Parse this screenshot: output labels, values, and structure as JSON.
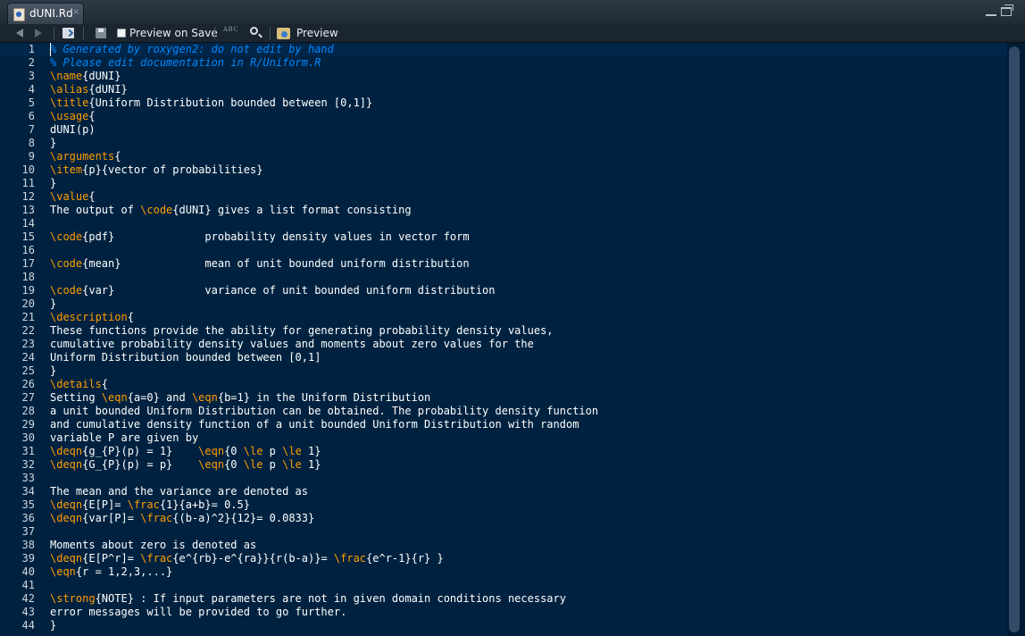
{
  "tab": {
    "title": "dUNI.Rd",
    "close": "×"
  },
  "toolbar": {
    "preview_on_save_label": "Preview on Save",
    "spellcheck_label": "ABC",
    "preview_label": "Preview"
  },
  "colors": {
    "background": "#002240",
    "keyword": "#ff9d00",
    "comment": "#0088ff",
    "text": "#ffffff"
  },
  "editor": {
    "lines": [
      [
        {
          "c": "cm",
          "t": "% Generated by roxygen2: do not edit by hand"
        }
      ],
      [
        {
          "c": "cm",
          "t": "% Please edit documentation in R/Uniform.R"
        }
      ],
      [
        {
          "c": "kw",
          "t": "\\name"
        },
        {
          "c": "",
          "t": "{dUNI}"
        }
      ],
      [
        {
          "c": "kw",
          "t": "\\alias"
        },
        {
          "c": "",
          "t": "{dUNI}"
        }
      ],
      [
        {
          "c": "kw",
          "t": "\\title"
        },
        {
          "c": "",
          "t": "{Uniform Distribution bounded between [0,1]}"
        }
      ],
      [
        {
          "c": "kw",
          "t": "\\usage"
        },
        {
          "c": "",
          "t": "{"
        }
      ],
      [
        {
          "c": "",
          "t": "dUNI(p)"
        }
      ],
      [
        {
          "c": "",
          "t": "}"
        }
      ],
      [
        {
          "c": "kw",
          "t": "\\arguments"
        },
        {
          "c": "",
          "t": "{"
        }
      ],
      [
        {
          "c": "kw",
          "t": "\\item"
        },
        {
          "c": "",
          "t": "{p}{vector of probabilities}"
        }
      ],
      [
        {
          "c": "",
          "t": "}"
        }
      ],
      [
        {
          "c": "kw",
          "t": "\\value"
        },
        {
          "c": "",
          "t": "{"
        }
      ],
      [
        {
          "c": "",
          "t": "The output of "
        },
        {
          "c": "kw",
          "t": "\\code"
        },
        {
          "c": "",
          "t": "{dUNI} gives a list format consisting"
        }
      ],
      [],
      [
        {
          "c": "kw",
          "t": "\\code"
        },
        {
          "c": "",
          "t": "{pdf}              probability density values in vector form"
        }
      ],
      [],
      [
        {
          "c": "kw",
          "t": "\\code"
        },
        {
          "c": "",
          "t": "{mean}             mean of unit bounded uniform distribution"
        }
      ],
      [],
      [
        {
          "c": "kw",
          "t": "\\code"
        },
        {
          "c": "",
          "t": "{var}              variance of unit bounded uniform distribution"
        }
      ],
      [
        {
          "c": "",
          "t": "}"
        }
      ],
      [
        {
          "c": "kw",
          "t": "\\description"
        },
        {
          "c": "",
          "t": "{"
        }
      ],
      [
        {
          "c": "",
          "t": "These functions provide the ability for generating probability density values,"
        }
      ],
      [
        {
          "c": "",
          "t": "cumulative probability density values and moments about zero values for the"
        }
      ],
      [
        {
          "c": "",
          "t": "Uniform Distribution bounded between [0,1]"
        }
      ],
      [
        {
          "c": "",
          "t": "}"
        }
      ],
      [
        {
          "c": "kw",
          "t": "\\details"
        },
        {
          "c": "",
          "t": "{"
        }
      ],
      [
        {
          "c": "",
          "t": "Setting "
        },
        {
          "c": "kw",
          "t": "\\eqn"
        },
        {
          "c": "",
          "t": "{a=0} and "
        },
        {
          "c": "kw",
          "t": "\\eqn"
        },
        {
          "c": "",
          "t": "{b=1} in the Uniform Distribution"
        }
      ],
      [
        {
          "c": "",
          "t": "a unit bounded Uniform Distribution can be obtained. The probability density function"
        }
      ],
      [
        {
          "c": "",
          "t": "and cumulative density function of a unit bounded Uniform Distribution with random"
        }
      ],
      [
        {
          "c": "",
          "t": "variable P are given by"
        }
      ],
      [
        {
          "c": "kw",
          "t": "\\deqn"
        },
        {
          "c": "",
          "t": "{g_{P}(p) = 1}    "
        },
        {
          "c": "kw",
          "t": "\\eqn"
        },
        {
          "c": "",
          "t": "{0 "
        },
        {
          "c": "kw",
          "t": "\\le"
        },
        {
          "c": "",
          "t": " p "
        },
        {
          "c": "kw",
          "t": "\\le"
        },
        {
          "c": "",
          "t": " 1}"
        }
      ],
      [
        {
          "c": "kw",
          "t": "\\deqn"
        },
        {
          "c": "",
          "t": "{G_{P}(p) = p}    "
        },
        {
          "c": "kw",
          "t": "\\eqn"
        },
        {
          "c": "",
          "t": "{0 "
        },
        {
          "c": "kw",
          "t": "\\le"
        },
        {
          "c": "",
          "t": " p "
        },
        {
          "c": "kw",
          "t": "\\le"
        },
        {
          "c": "",
          "t": " 1}"
        }
      ],
      [],
      [
        {
          "c": "",
          "t": "The mean and the variance are denoted as"
        }
      ],
      [
        {
          "c": "kw",
          "t": "\\deqn"
        },
        {
          "c": "",
          "t": "{E[P]= "
        },
        {
          "c": "kw",
          "t": "\\frac"
        },
        {
          "c": "",
          "t": "{1}{a+b}= 0.5}"
        }
      ],
      [
        {
          "c": "kw",
          "t": "\\deqn"
        },
        {
          "c": "",
          "t": "{var[P]= "
        },
        {
          "c": "kw",
          "t": "\\frac"
        },
        {
          "c": "",
          "t": "{(b-a)^2}{12}= 0.0833}"
        }
      ],
      [],
      [
        {
          "c": "",
          "t": "Moments about zero is denoted as"
        }
      ],
      [
        {
          "c": "kw",
          "t": "\\deqn"
        },
        {
          "c": "",
          "t": "{E[P^r]= "
        },
        {
          "c": "kw",
          "t": "\\frac"
        },
        {
          "c": "",
          "t": "{e^{rb}-e^{ra}}{r(b-a)}= "
        },
        {
          "c": "kw",
          "t": "\\frac"
        },
        {
          "c": "",
          "t": "{e^r-1}{r} }"
        }
      ],
      [
        {
          "c": "kw",
          "t": "\\eqn"
        },
        {
          "c": "",
          "t": "{r = 1,2,3,...}"
        }
      ],
      [],
      [
        {
          "c": "kw",
          "t": "\\strong"
        },
        {
          "c": "",
          "t": "{NOTE} : If input parameters are not in given domain conditions necessary"
        }
      ],
      [
        {
          "c": "",
          "t": "error messages will be provided to go further."
        }
      ],
      [
        {
          "c": "",
          "t": "}"
        }
      ]
    ]
  }
}
